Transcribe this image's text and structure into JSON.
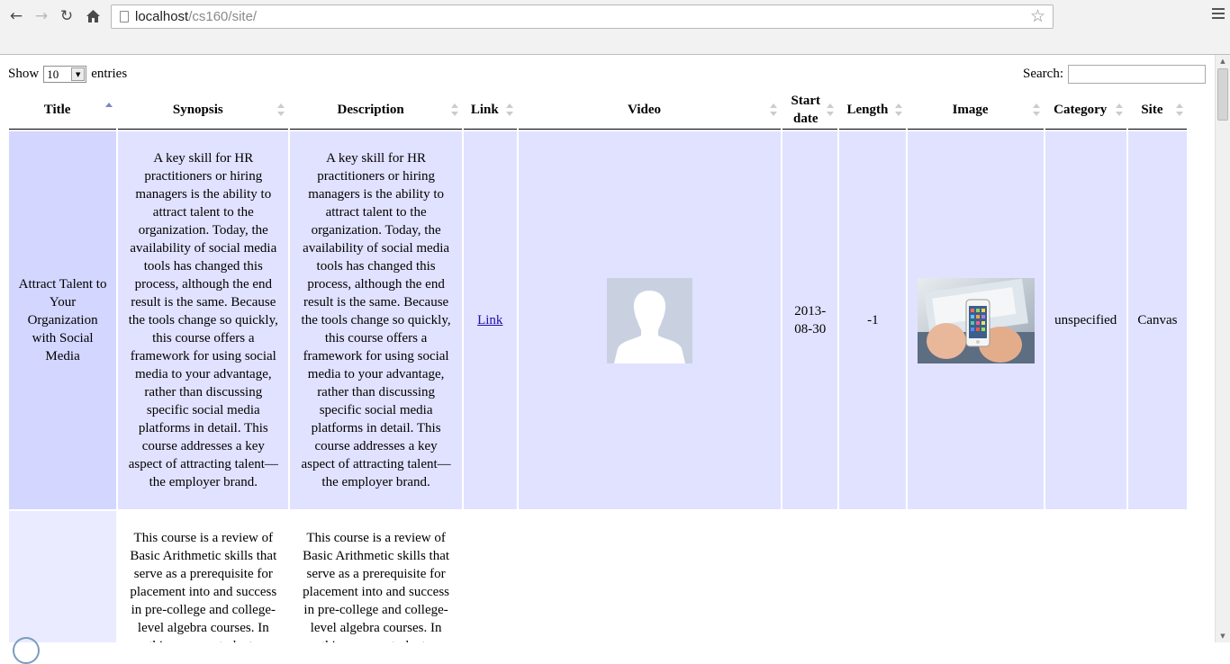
{
  "browser": {
    "url_host": "localhost",
    "url_path": "/cs160/site/",
    "nav_icons": [
      "back-icon",
      "forward-icon",
      "reload-icon",
      "home-icon"
    ],
    "bookmark_icon": "star-icon",
    "menu_icon": "menu-icon"
  },
  "controls": {
    "show_label": "Show",
    "entries_value": "10",
    "entries_label": "entries",
    "search_label": "Search:",
    "search_value": ""
  },
  "table": {
    "columns": [
      "Title",
      "Synopsis",
      "Description",
      "Link",
      "Video",
      "Start date",
      "Length",
      "Image",
      "Category",
      "Site"
    ],
    "sorted_column": "Title",
    "sort_direction": "asc",
    "rows": [
      {
        "title": "Attract Talent to Your Organization with Social Media",
        "synopsis": "A key skill for HR practitioners or hiring managers is the ability to attract talent to the organization. Today, the availability of social media tools has changed this process, although the end result is the same. Because the tools change so quickly, this course offers a framework for using social media to your advantage, rather than discussing specific social media platforms in detail. This course addresses a key aspect of attracting talent—the employer brand.",
        "description": "A key skill for HR practitioners or hiring managers is the ability to attract talent to the organization. Today, the availability of social media tools has changed this process, although the end result is the same. Because the tools change so quickly, this course offers a framework for using social media to your advantage, rather than discussing specific social media platforms in detail. This course addresses a key aspect of attracting talent—the employer brand.",
        "link": "Link",
        "video": "default-avatar-placeholder",
        "start_date": "2013-08-30",
        "length": "-1",
        "image": "hands-holding-smartphone-photo",
        "category": "unspecified",
        "site": "Canvas"
      },
      {
        "title": "",
        "synopsis": "This course is a review of Basic Arithmetic skills that serve as a prerequisite for placement into and success in pre-college and college-level algebra courses. In this course, students",
        "description": "This course is a review of Basic Arithmetic skills that serve as a prerequisite for placement into and success in pre-college and college-level algebra courses. In this course, students",
        "link": "",
        "video": "",
        "start_date": "",
        "length": "",
        "image": "",
        "category": "",
        "site": ""
      }
    ]
  }
}
